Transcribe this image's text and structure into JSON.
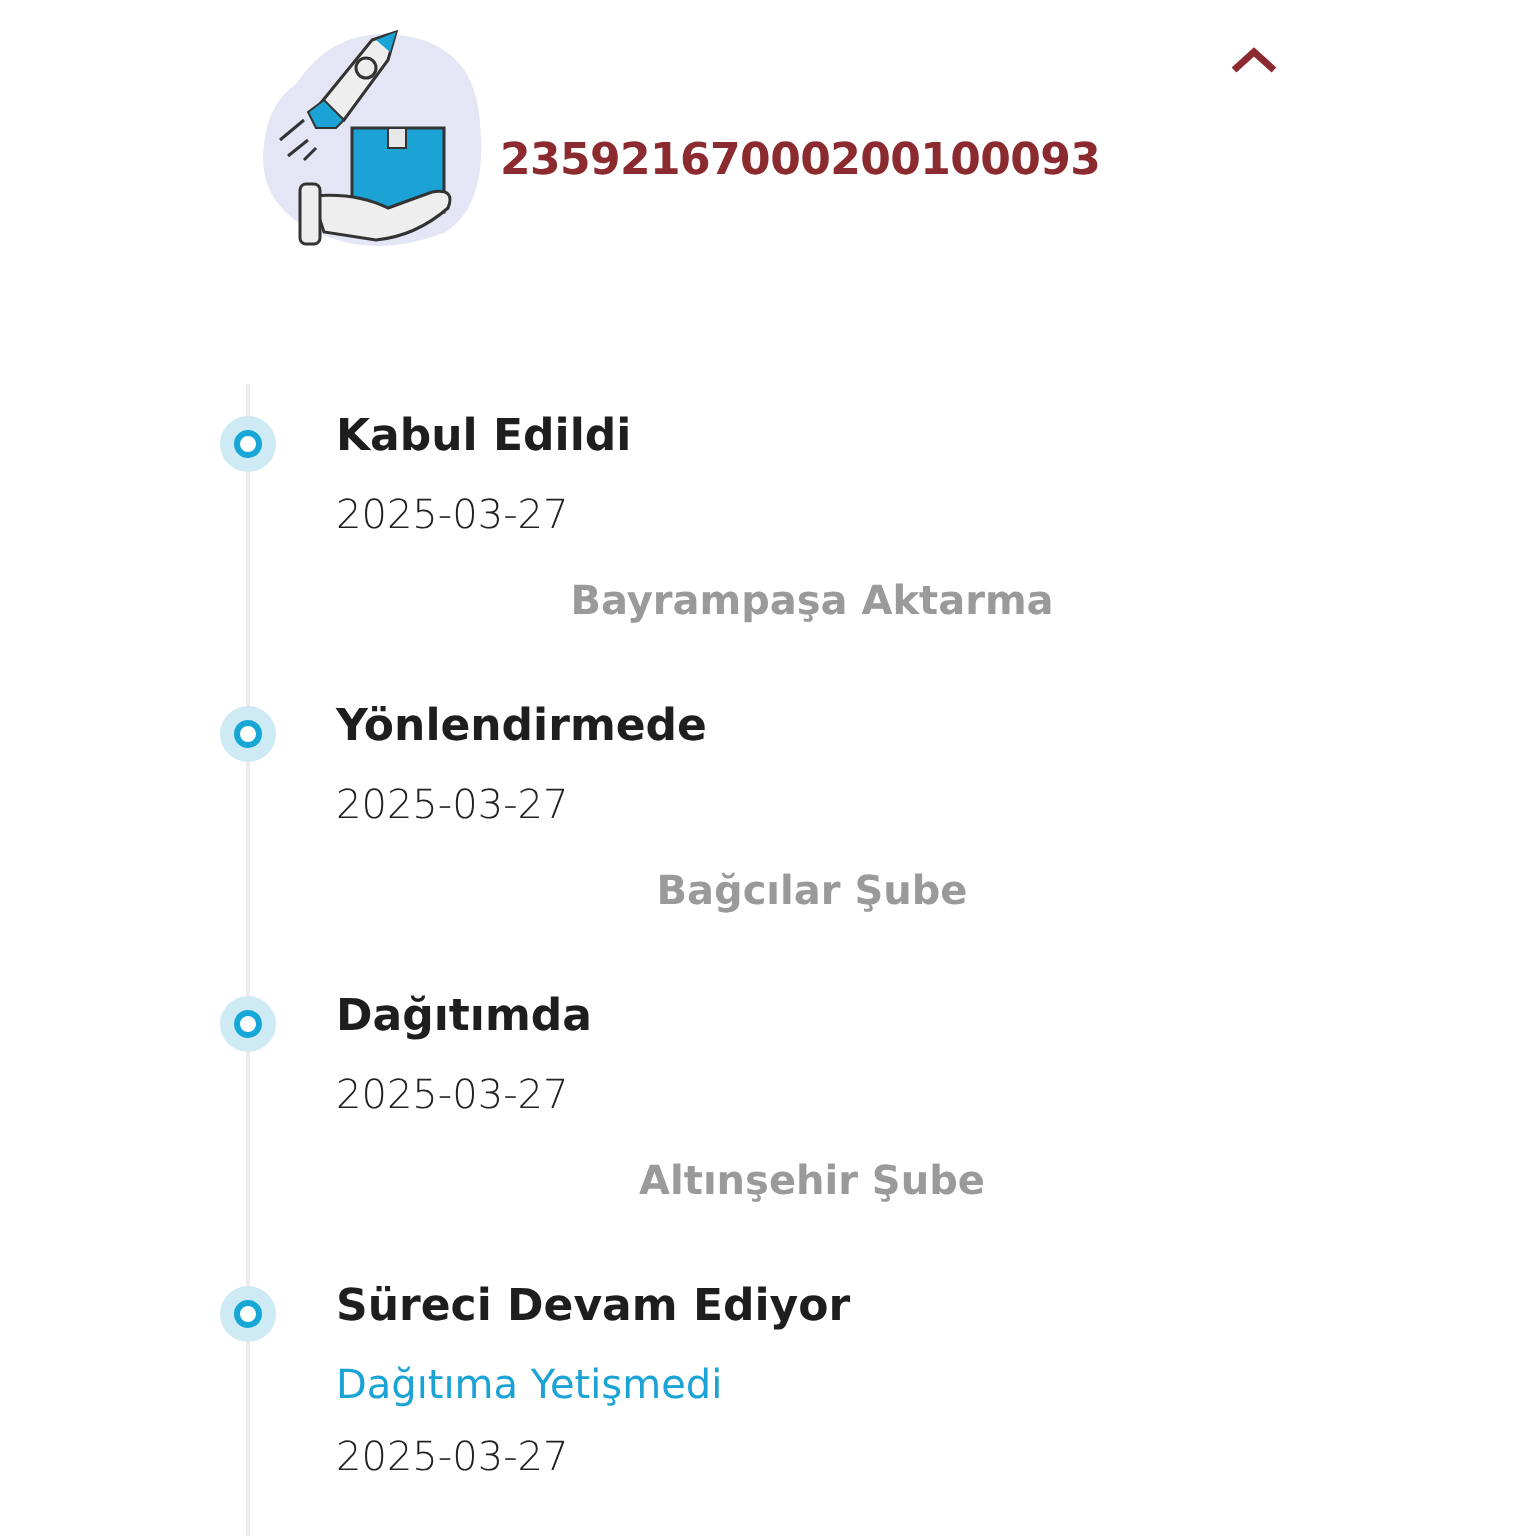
{
  "tracking_number": "23592167000200100093",
  "collapse_toggle": {
    "expanded": true
  },
  "events": [
    {
      "status": "Kabul Edildi",
      "date": "2025-03-27",
      "location": "Bayrampaşa Aktarma"
    },
    {
      "status": "Yönlendirmede",
      "date": "2025-03-27",
      "location": "Bağcılar Şube"
    },
    {
      "status": "Dağıtımda",
      "date": "2025-03-27",
      "location": "Altınşehir Şube"
    },
    {
      "status": "Süreci Devam Ediyor",
      "note": "Dağıtıma Yetişmedi",
      "date": "2025-03-27"
    }
  ]
}
